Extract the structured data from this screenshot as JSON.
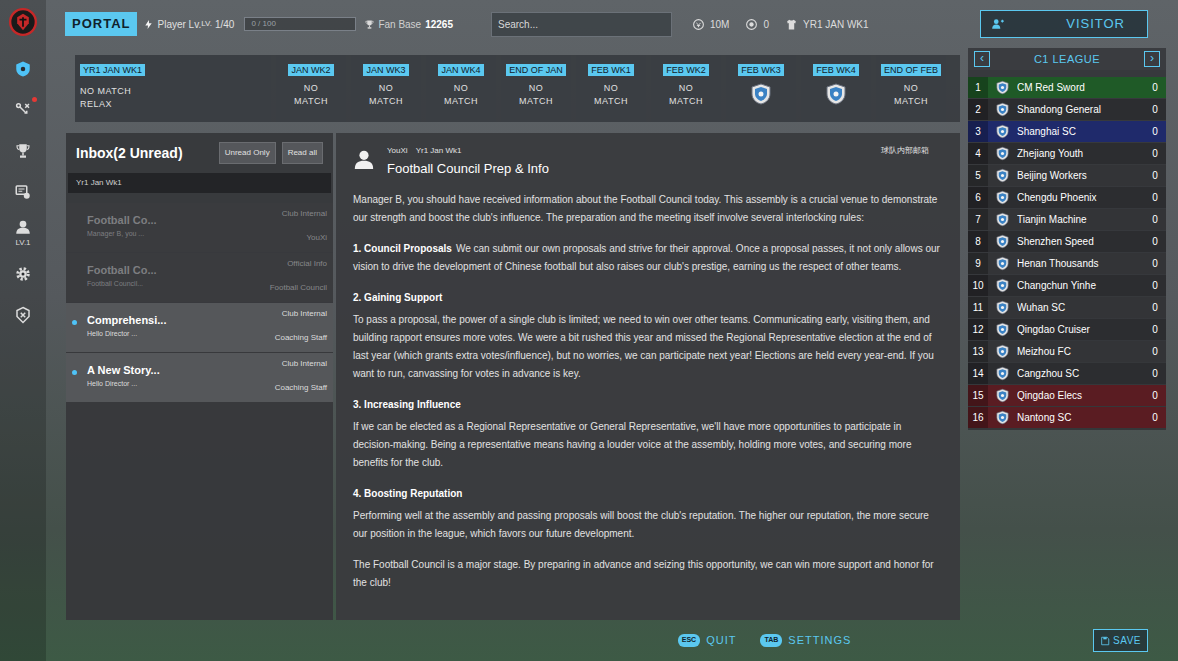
{
  "sidebar": {
    "items": [
      {
        "kind": "home",
        "selected": true,
        "notify": false,
        "label": ""
      },
      {
        "kind": "tactics",
        "selected": false,
        "notify": true,
        "label": ""
      },
      {
        "kind": "trophy",
        "selected": false,
        "notify": false,
        "label": ""
      },
      {
        "kind": "transfer",
        "selected": false,
        "notify": false,
        "label": ""
      },
      {
        "kind": "profile",
        "selected": false,
        "notify": false,
        "label": "LV.1"
      },
      {
        "kind": "settings",
        "selected": false,
        "notify": false,
        "label": ""
      },
      {
        "kind": "badge",
        "selected": false,
        "notify": false,
        "label": ""
      }
    ]
  },
  "topbar": {
    "portal": "PORTAL",
    "player_level": {
      "label": "Player Lv.",
      "small": "LV.",
      "value": "1/40"
    },
    "exp": {
      "text": "0 / 100",
      "level": 0
    },
    "fan_base": {
      "label": "Fan Base",
      "value": "12265"
    },
    "search": {
      "placeholder": "Search..."
    },
    "stats": [
      {
        "kind": "money",
        "value": "10M"
      },
      {
        "kind": "coin",
        "value": "0"
      },
      {
        "kind": "date",
        "value": "YR1 JAN WK1"
      }
    ],
    "visitor": "VISITOR"
  },
  "schedule": [
    {
      "label": "YR1 JAN WK1",
      "lines": [
        "NO MATCH",
        "RELAX"
      ],
      "kind": "current"
    },
    {
      "label": "JAN WK2",
      "lines": [
        "NO",
        "MATCH"
      ],
      "kind": "text"
    },
    {
      "label": "JAN WK3",
      "lines": [
        "NO",
        "MATCH"
      ],
      "kind": "text"
    },
    {
      "label": "JAN WK4",
      "lines": [
        "NO",
        "MATCH"
      ],
      "kind": "text"
    },
    {
      "label": "END OF JAN",
      "lines": [
        "NO",
        "MATCH"
      ],
      "kind": "text"
    },
    {
      "label": "FEB WK1",
      "lines": [
        "NO",
        "MATCH"
      ],
      "kind": "text"
    },
    {
      "label": "FEB WK2",
      "lines": [
        "NO",
        "MATCH"
      ],
      "kind": "text"
    },
    {
      "label": "FEB WK3",
      "lines": [],
      "kind": "match"
    },
    {
      "label": "FEB WK4",
      "lines": [],
      "kind": "match"
    },
    {
      "label": "END OF FEB",
      "lines": [
        "NO",
        "MATCH"
      ],
      "kind": "text"
    }
  ],
  "inbox": {
    "title": "Inbox(2 Unread)",
    "buttons": [
      "Unread Only",
      "Read all"
    ],
    "date": "Yr1 Jan Wk1",
    "messages": [
      {
        "title": "Football Co...",
        "preview": "Manager B, you ...",
        "category": "Club Internal",
        "sender": "YouXi",
        "unread": false
      },
      {
        "title": "Football Co...",
        "preview": "Football Council...",
        "category": "Official Info",
        "sender": "Football Council",
        "unread": false
      },
      {
        "title": "Comprehensi...",
        "preview": "Hello Director ...",
        "category": "Club Internal",
        "sender": "Coaching Staff",
        "unread": true
      },
      {
        "title": "A New Story...",
        "preview": "Hello Director ...",
        "category": "Club Internal",
        "sender": "Coaching Staff",
        "unread": true
      }
    ]
  },
  "message": {
    "sender": "YouXi",
    "date": "Yr1 Jan Wk1",
    "mailbox": "球队内部邮箱",
    "title": "Football Council Prep & Info",
    "intro": "Manager B, you should have received information about the Football Council today. This assembly is a crucial venue to demonstrate our strength and boost the club's influence. The preparation and the meeting itself involve several interlocking rules:",
    "sections": [
      {
        "heading": "1. Council Proposals",
        "text": "We can submit our own proposals and strive for their approval. Once a proposal passes, it not only allows our vision to drive the development of Chinese football but also raises our club's prestige, earning us the respect of other teams.",
        "kind": "inline"
      },
      {
        "heading": "2. Gaining Support",
        "text": "To pass a proposal, the power of a single club is limited; we need to win over other teams. Communicating early, visiting them, and building rapport ensures more votes. We were a bit rushed this year and missed the Regional Representative election at the end of last year (which grants extra votes/influence), but no worries, we can participate next year! Elections are held every year-end. If you want to run, canvassing for votes in advance is key.",
        "kind": "block"
      },
      {
        "heading": "3. Increasing Influence",
        "text": "If we can be elected as a Regional Representative or General Representative, we'll have more opportunities to participate in decision-making. Being a representative means having a louder voice at the assembly, holding more votes, and securing more benefits for the club.",
        "kind": "block"
      },
      {
        "heading": "4. Boosting Reputation",
        "text": "Performing well at the assembly and passing proposals will boost the club's reputation. The higher our reputation, the more secure our position in the league, which favors our future development.",
        "kind": "block"
      }
    ],
    "closing": "The Football Council is a major stage. By preparing in advance and seizing this opportunity, we can win more support and honor for the club!"
  },
  "league": {
    "title": "C1 LEAGUE",
    "prev": "‹",
    "next": "›",
    "rows": [
      {
        "rank": "1",
        "name": "CM Red Sword",
        "points": "0",
        "color": "#1f5a27"
      },
      {
        "rank": "2",
        "name": "Shandong General",
        "points": "0",
        "color": "#2c2d30"
      },
      {
        "rank": "3",
        "name": "Shanghai SC",
        "points": "0",
        "color": "#1f2a6b"
      },
      {
        "rank": "4",
        "name": "Zhejiang Youth",
        "points": "0",
        "color": "#2c2d30"
      },
      {
        "rank": "5",
        "name": "Beijing Workers",
        "points": "0",
        "color": "#333437"
      },
      {
        "rank": "6",
        "name": "Chengdu Phoenix",
        "points": "0",
        "color": "#2c2d30"
      },
      {
        "rank": "7",
        "name": "Tianjin Machine",
        "points": "0",
        "color": "#333437"
      },
      {
        "rank": "8",
        "name": "Shenzhen Speed",
        "points": "0",
        "color": "#2c2d30"
      },
      {
        "rank": "9",
        "name": "Henan Thousands",
        "points": "0",
        "color": "#333437"
      },
      {
        "rank": "10",
        "name": "Changchun Yinhe",
        "points": "0",
        "color": "#2c2d30"
      },
      {
        "rank": "11",
        "name": "Wuhan SC",
        "points": "0",
        "color": "#333437"
      },
      {
        "rank": "12",
        "name": "Qingdao Cruiser",
        "points": "0",
        "color": "#2c2d30"
      },
      {
        "rank": "13",
        "name": "Meizhou FC",
        "points": "0",
        "color": "#333437"
      },
      {
        "rank": "14",
        "name": "Cangzhou SC",
        "points": "0",
        "color": "#2c2d30"
      },
      {
        "rank": "15",
        "name": "Qingdao Elecs",
        "points": "0",
        "color": "#5a1c22"
      },
      {
        "rank": "16",
        "name": "Nantong SC",
        "points": "0",
        "color": "#5a1c22"
      }
    ]
  },
  "footer": {
    "keys": [
      {
        "key": "ESC",
        "label": "QUIT"
      },
      {
        "key": "TAB",
        "label": "SETTINGS"
      }
    ],
    "save": "SAVE"
  }
}
